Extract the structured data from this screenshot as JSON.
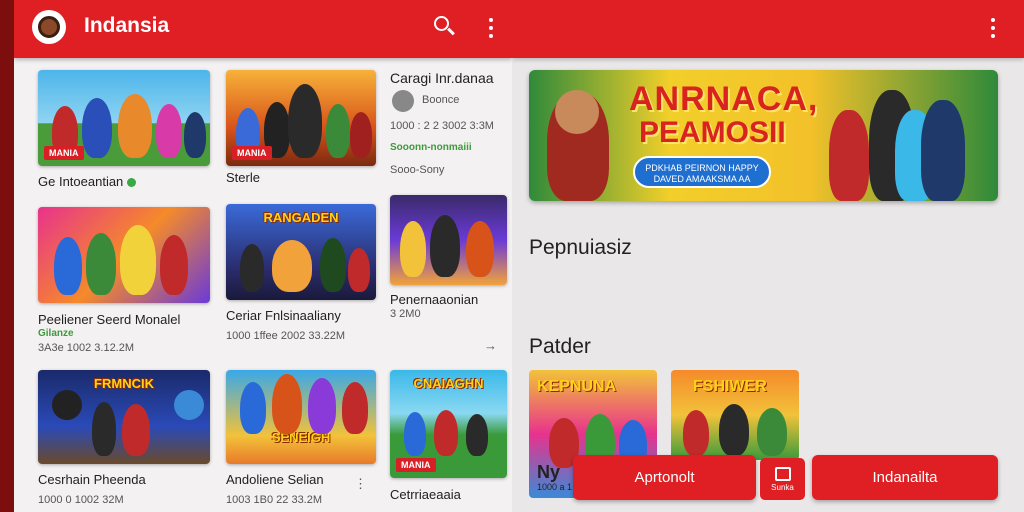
{
  "app": {
    "title": "Indansia"
  },
  "grid": [
    {
      "title": "Ge Intoeantian",
      "meta": "",
      "green": "",
      "badge": "MANIA",
      "logo": ""
    },
    {
      "title": "Sterle",
      "meta": "",
      "green": "",
      "badge": "MANIA",
      "logo": ""
    },
    {
      "title": "Caragi Inr.danaa",
      "meta": "1000 : 2 2 3002 3:3M",
      "green": "Boonce",
      "sub": "Sooonn-nonmaiii",
      "badge": "",
      "logo": ""
    },
    {
      "title": "Peeliener Seerd Monalel",
      "meta": "3A3e 1002 3.12.2M",
      "green": "Gilanze",
      "badge": "",
      "logo": ""
    },
    {
      "title": "Ceriar Fnlsinaaliany",
      "meta": "1000 1ffee 2002 33.22M",
      "green": "",
      "badge": "",
      "logo": "RANGADEN"
    },
    {
      "title": "Penernaaonian",
      "meta": "3 2M0",
      "green": "",
      "badge": "",
      "logo": ""
    },
    {
      "title": "Cesrhain Pheenda",
      "meta": "1000 0 1002 32M",
      "green": "",
      "badge": "",
      "logo": "FRMNCIK"
    },
    {
      "title": "Andoliene Selian",
      "meta": "1003 1B0 22 33.2M",
      "green": "",
      "badge": "",
      "logo": "SENEIGH"
    },
    {
      "title": "Cetrriaeaaia",
      "meta": "",
      "green": "",
      "badge": "MANIA",
      "logo": "CNAIAGHN"
    }
  ],
  "row2_extra": {
    "sub_label": "Sooo-Sony"
  },
  "banner": {
    "headline1": "ANRNACA,",
    "headline2": "PEAMOSII",
    "pill": "PDKHAB PEIRNON HAPPY\nDAVED AMAAKSMA AA"
  },
  "sections": {
    "s1": "Pepnuiasiz",
    "s2": "Patder"
  },
  "games": [
    {
      "logo": "KEPNUNA",
      "caption": "Ny",
      "meta": "1000 a 1 20"
    },
    {
      "logo": "FSHIWER",
      "caption": "",
      "meta": ""
    }
  ],
  "buttons": {
    "primary": "Aprtonolt",
    "icon_label": "Sunka",
    "secondary": "Indanailta"
  }
}
